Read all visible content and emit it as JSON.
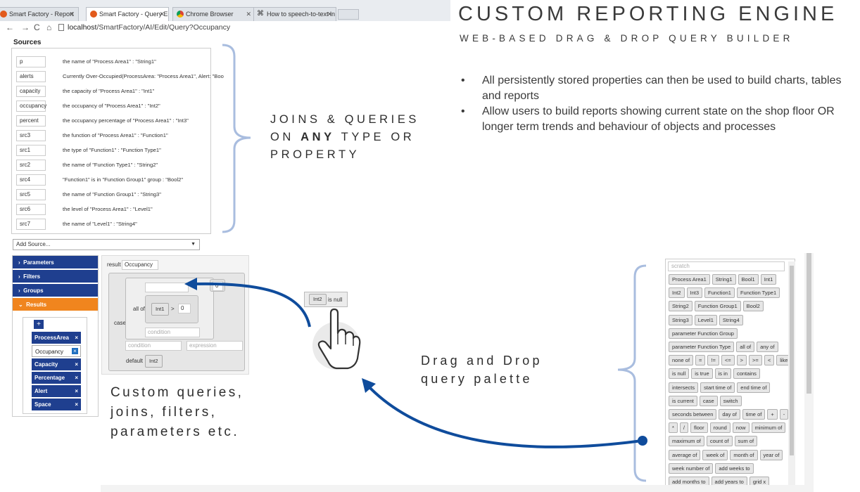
{
  "browser": {
    "tabs": [
      {
        "label": "Smart Factory - Report"
      },
      {
        "label": "Smart Factory - Query Edi"
      },
      {
        "label": "Chrome Browser"
      },
      {
        "label": "How to speech-to-text in"
      }
    ],
    "url_host": "localhost",
    "url_path": "/SmartFactory/AI/Edit/Query?Occupancy"
  },
  "heading": {
    "title": "CUSTOM REPORTING ENGINE",
    "subtitle": "WEB-BASED DRAG & DROP QUERY BUILDER",
    "bullets": [
      "All persistently stored properties can then be used to build charts, tables and reports",
      "Allow users to build reports showing current state on the shop floor OR longer term trends and behaviour of objects and processes"
    ]
  },
  "callouts": {
    "joins_line1": "JOINS & QUERIES",
    "joins_line2_pre": "ON ",
    "joins_line2_bold": "ANY",
    "joins_line2_post": " TYPE OR",
    "joins_line3": "PROPERTY",
    "custom_line1": "Custom queries,",
    "custom_line2": "joins, filters,",
    "custom_line3": "parameters etc.",
    "drag_line1": "Drag and Drop",
    "drag_line2": "query palette"
  },
  "sources": {
    "title": "Sources",
    "rows": [
      {
        "key": "p",
        "desc": "the name of \"Process Area1\" : \"String1\""
      },
      {
        "key": "alerts",
        "desc": "Currently Over-Occupied(ProcessArea: \"Process Area1\", Alert: \"Boo"
      },
      {
        "key": "capacity",
        "desc": "the capacity of \"Process Area1\" : \"Int1\""
      },
      {
        "key": "occupancy",
        "desc": "the occupancy of \"Process Area1\" : \"Int2\""
      },
      {
        "key": "percent",
        "desc": "the occupancy percentage of \"Process Area1\" : \"Int3\""
      },
      {
        "key": "src3",
        "desc": "the function of \"Process Area1\" : \"Function1\""
      },
      {
        "key": "src1",
        "desc": "the type of \"Function1\" : \"Function Type1\""
      },
      {
        "key": "src2",
        "desc": "the name of \"Function Type1\" : \"String2\""
      },
      {
        "key": "src4",
        "desc": "\"Function1\" is in \"Function Group1\" group : \"Bool2\""
      },
      {
        "key": "src5",
        "desc": "the name of \"Function Group1\" : \"String3\""
      },
      {
        "key": "src6",
        "desc": "the level of \"Process Area1\" : \"Level1\""
      },
      {
        "key": "src7",
        "desc": "the name of \"Level1\" : \"String4\""
      }
    ],
    "add_source_placeholder": "Add Source..."
  },
  "sidebar": {
    "sections": [
      {
        "label": "Parameters",
        "arrow": "›"
      },
      {
        "label": "Filters",
        "arrow": "›"
      },
      {
        "label": "Groups",
        "arrow": "›"
      },
      {
        "label": "Results",
        "arrow": "⌄"
      }
    ],
    "add_label": "+",
    "results": [
      {
        "label": "ProcessArea"
      },
      {
        "label": "Occupancy"
      },
      {
        "label": "Capacity"
      },
      {
        "label": "Percentage"
      },
      {
        "label": "Alert"
      },
      {
        "label": "Space"
      }
    ],
    "remove_label": "×"
  },
  "query": {
    "result_label": "result",
    "result_value": "Occupancy",
    "all_of_label": "all of",
    "int1_chip": "Int1",
    "gt_label": ">",
    "zero_value": "0",
    "then_value": "0",
    "case_label": "case",
    "condition_placeholder": "condition",
    "expression_placeholder": "expression",
    "default_label": "default",
    "default_chip": "Int2",
    "drag_chip": "Int2",
    "drag_suffix": "is null"
  },
  "palette": {
    "scratch_placeholder": "scratch",
    "rows": [
      [
        "Process Area1",
        "String1",
        "Bool1",
        "Int1"
      ],
      [
        "Int2",
        "Int3",
        "Function1",
        "Function Type1"
      ],
      [
        "String2",
        "Function Group1",
        "Bool2"
      ],
      [
        "String3",
        "Level1",
        "String4"
      ],
      [
        "parameter Function Group"
      ],
      [
        "parameter Function Type",
        "all of",
        "any of"
      ],
      [
        "none of",
        "=",
        "!=",
        "<=",
        ">",
        ">=",
        "<",
        "like"
      ],
      [
        "is null",
        "is true",
        "is in",
        "contains"
      ],
      [
        "intersects",
        "start time of",
        "end time of"
      ],
      [
        "is current",
        "case",
        "switch"
      ],
      [
        "seconds between",
        "day of",
        "time of",
        "+",
        "-"
      ],
      [
        "*",
        "/",
        "floor",
        "round",
        "now",
        "minimum of"
      ],
      [
        "maximum of",
        "count of",
        "sum of"
      ],
      [
        "average of",
        "week of",
        "month of",
        "year of"
      ],
      [
        "week number of",
        "add weeks to"
      ],
      [
        "add months to",
        "add years to",
        "grid x"
      ]
    ]
  },
  "colors": {
    "accent_blue": "#1f3f8f",
    "accent_orange": "#f0851e",
    "arrow_blue": "#0f4c9c",
    "brace": "#a9bddf"
  }
}
